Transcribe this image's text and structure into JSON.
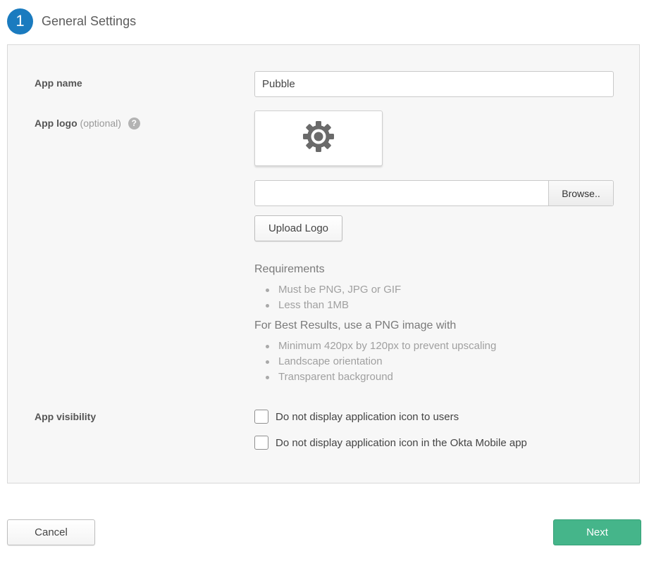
{
  "step": {
    "number": "1",
    "title": "General Settings"
  },
  "form": {
    "app_name": {
      "label": "App name",
      "value": "Pubble"
    },
    "app_logo": {
      "label": "App logo",
      "optional_text": "(optional)",
      "help_icon": "?",
      "preview_icon": "gear-icon",
      "file_path_value": "",
      "browse_label": "Browse..",
      "upload_label": "Upload Logo"
    },
    "requirements": {
      "heading": "Requirements",
      "items": [
        "Must be PNG, JPG or GIF",
        "Less than 1MB"
      ]
    },
    "best_results": {
      "heading": "For Best Results, use a PNG image with",
      "items": [
        "Minimum 420px by 120px to prevent upscaling",
        "Landscape orientation",
        "Transparent background"
      ]
    },
    "app_visibility": {
      "label": "App visibility",
      "options": [
        {
          "label": "Do not display application icon to users",
          "checked": false
        },
        {
          "label": "Do not display application icon in the Okta Mobile app",
          "checked": false
        }
      ]
    }
  },
  "footer": {
    "cancel_label": "Cancel",
    "next_label": "Next"
  },
  "colors": {
    "step_blue": "#1a7bbf",
    "next_green": "#45b58a",
    "panel_bg": "#f7f7f7"
  }
}
